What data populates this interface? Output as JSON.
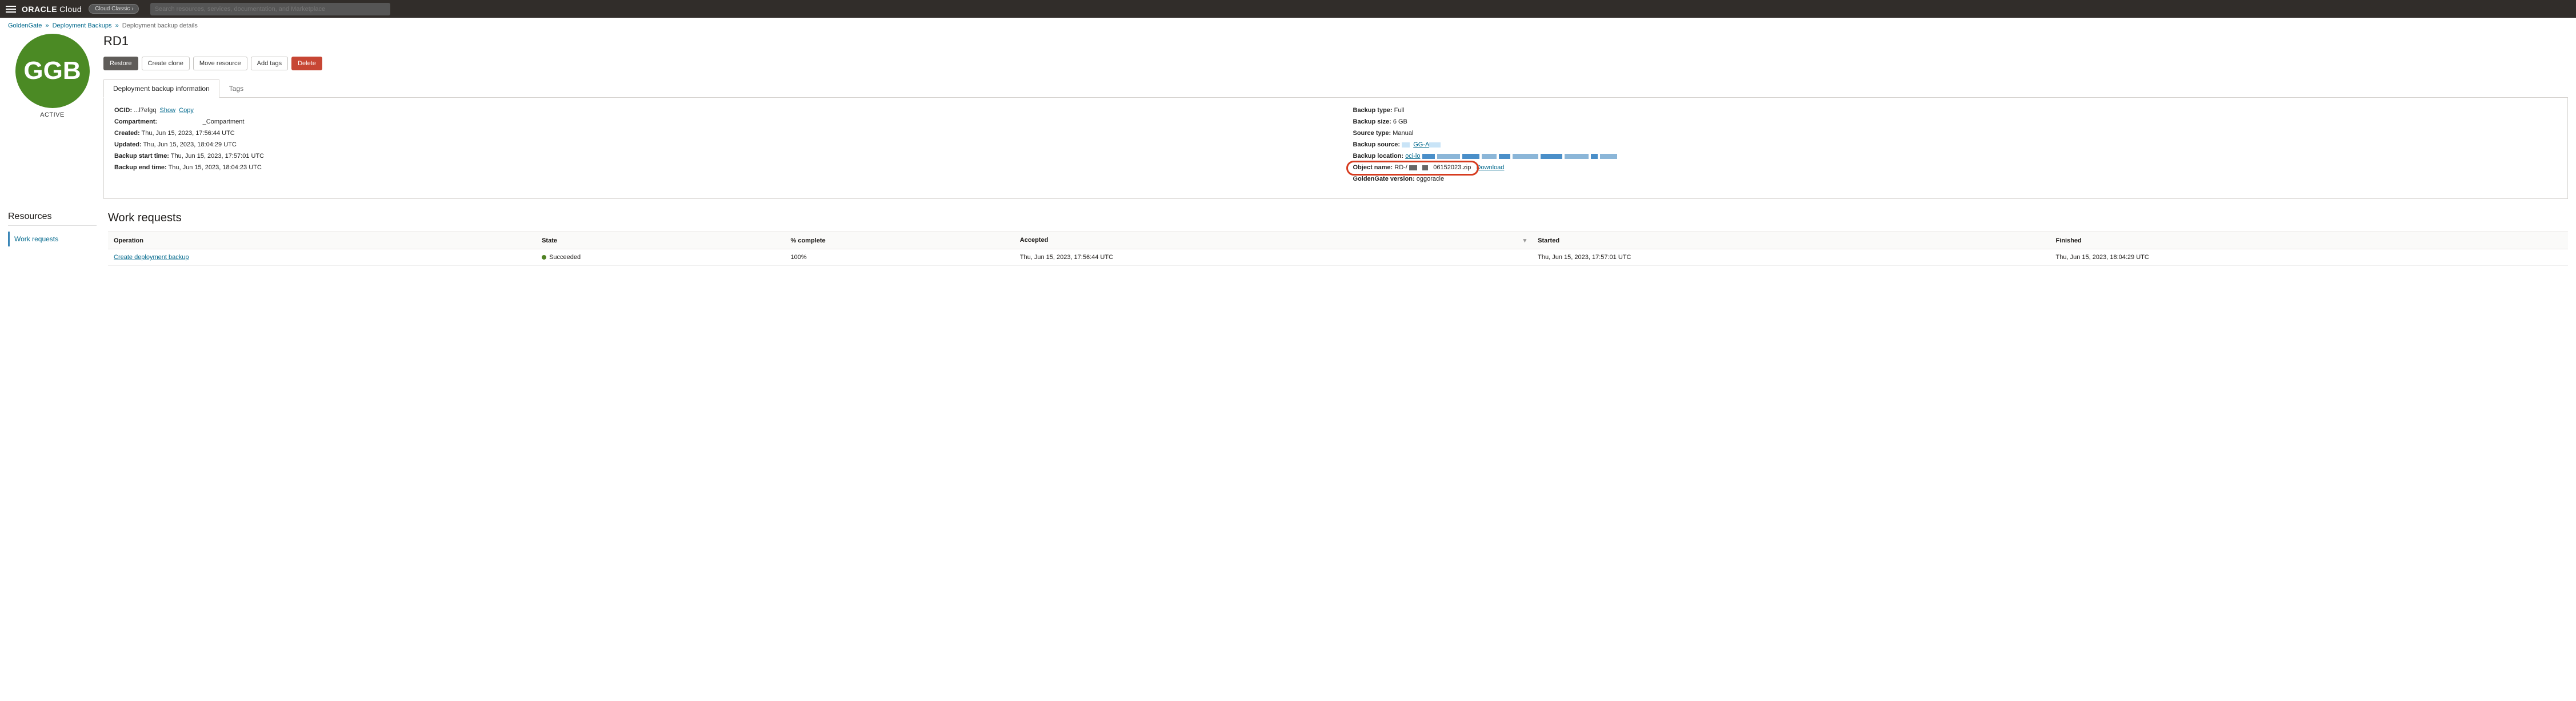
{
  "header": {
    "brand_bold": "ORACLE",
    "brand_light": "Cloud",
    "classic_label": "Cloud Classic",
    "search_placeholder": "Search resources, services, documentation, and Marketplace"
  },
  "breadcrumb": {
    "items": [
      "GoldenGate",
      "Deployment Backups"
    ],
    "current": "Deployment backup details"
  },
  "badge": {
    "initials": "GGB",
    "status": "ACTIVE"
  },
  "page": {
    "title": "RD1"
  },
  "actions": {
    "restore": "Restore",
    "create_clone": "Create clone",
    "move_resource": "Move resource",
    "add_tags": "Add tags",
    "delete": "Delete"
  },
  "tabs": {
    "info": "Deployment backup information",
    "tags": "Tags"
  },
  "info_left": {
    "ocid_label": "OCID:",
    "ocid_val": "...l7efgq",
    "show": "Show",
    "copy": "Copy",
    "compartment_label": "Compartment:",
    "compartment_val": "_Compartment",
    "created_label": "Created:",
    "created_val": "Thu, Jun 15, 2023, 17:56:44 UTC",
    "updated_label": "Updated:",
    "updated_val": "Thu, Jun 15, 2023, 18:04:29 UTC",
    "start_label": "Backup start time:",
    "start_val": "Thu, Jun 15, 2023, 17:57:01 UTC",
    "end_label": "Backup end time:",
    "end_val": "Thu, Jun 15, 2023, 18:04:23 UTC"
  },
  "info_right": {
    "type_label": "Backup type:",
    "type_val": "Full",
    "size_label": "Backup size:",
    "size_val": "6 GB",
    "source_type_label": "Source type:",
    "source_type_val": "Manual",
    "source_label": "Backup source:",
    "source_link": "GG-A",
    "location_label": "Backup location:",
    "location_val": "oci-lo",
    "object_label": "Object name:",
    "object_prefix": "RD-/",
    "object_suffix": "06152023.zip",
    "download": "Download",
    "gg_version_label": "GoldenGate version:",
    "gg_version_val": "oggoracle"
  },
  "sidebar": {
    "title": "Resources",
    "item": "Work requests"
  },
  "work": {
    "title": "Work requests",
    "columns": {
      "operation": "Operation",
      "state": "State",
      "complete": "% complete",
      "accepted": "Accepted",
      "started": "Started",
      "finished": "Finished"
    },
    "row": {
      "operation": "Create deployment backup",
      "state": "Succeeded",
      "complete": "100%",
      "accepted": "Thu, Jun 15, 2023, 17:56:44 UTC",
      "started": "Thu, Jun 15, 2023, 17:57:01 UTC",
      "finished": "Thu, Jun 15, 2023, 18:04:29 UTC"
    }
  }
}
